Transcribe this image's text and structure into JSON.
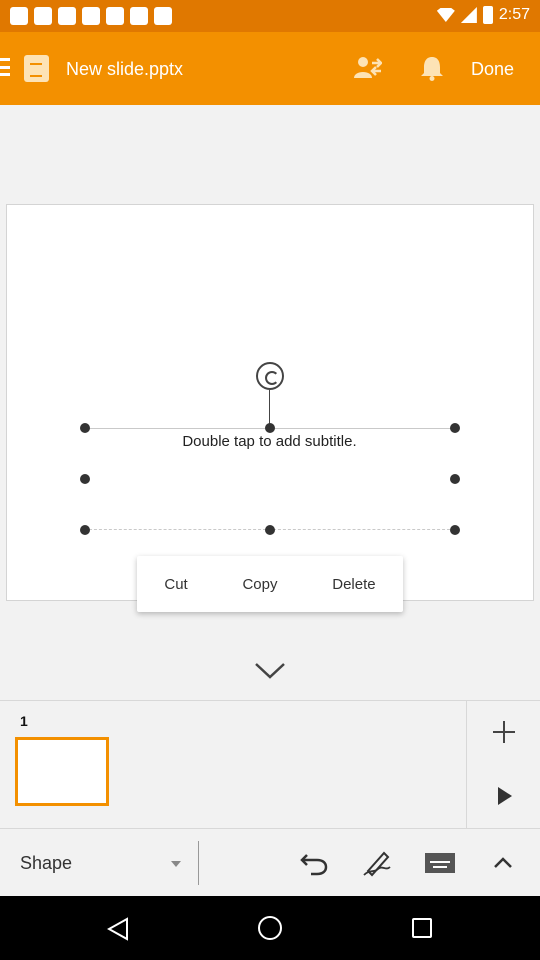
{
  "status_bar": {
    "time": "2:57"
  },
  "app_bar": {
    "file_name": "New slide.pptx",
    "done_label": "Done"
  },
  "slide": {
    "placeholder_text": "Double tap to add subtitle."
  },
  "context_menu": {
    "cut": "Cut",
    "copy": "Copy",
    "delete": "Delete"
  },
  "slides_panel": {
    "current_slide_number": "1"
  },
  "toolbar": {
    "shape_label": "Shape"
  },
  "colors": {
    "accent": "#f39000",
    "status_bar": "#e07800"
  }
}
